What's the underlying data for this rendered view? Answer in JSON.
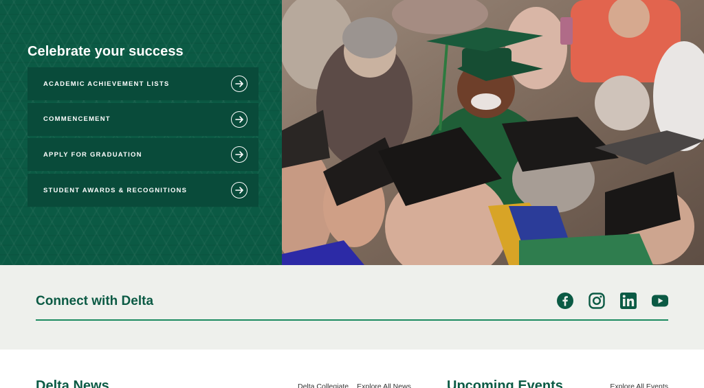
{
  "hero": {
    "title": "Celebrate your success",
    "links": [
      {
        "label": "ACADEMIC ACHIEVEMENT LISTS",
        "icon": "arrow-right-circle-icon"
      },
      {
        "label": "COMMENCEMENT",
        "icon": "arrow-right-circle-icon"
      },
      {
        "label": "APPLY FOR GRADUATION",
        "icon": "arrow-right-circle-icon"
      },
      {
        "label": "STUDENT AWARDS & RECOGNITIONS",
        "icon": "arrow-right-circle-icon"
      }
    ]
  },
  "connect": {
    "title": "Connect with Delta",
    "social": [
      "facebook-icon",
      "instagram-icon",
      "linkedin-icon",
      "youtube-icon"
    ]
  },
  "news": {
    "title": "Delta News",
    "links": [
      "Delta Collegiate",
      "Explore All News"
    ]
  },
  "events": {
    "title": "Upcoming Events",
    "link": "Explore All Events"
  },
  "colors": {
    "brand_green": "#0b5a44",
    "button_green": "#094b3a",
    "accent_rule": "#1a8a5f",
    "connect_bg": "#eef0ec"
  }
}
